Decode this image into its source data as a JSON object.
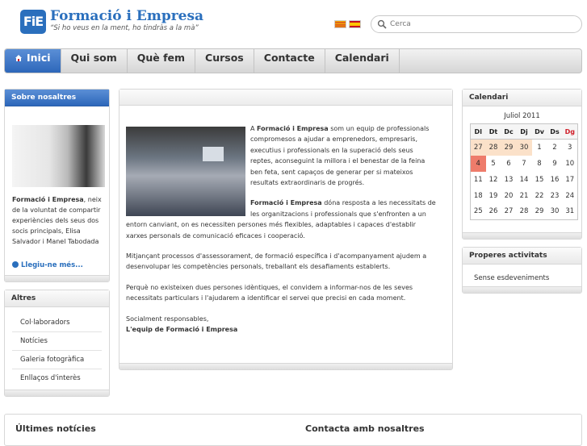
{
  "header": {
    "logo_text": "FiE",
    "site_name": "Formació i Empresa",
    "tagline": "“Si ho veus en la ment, ho tindràs a la mà”",
    "search_placeholder": "Cerca",
    "icons": [
      "catalan-flag-icon",
      "spanish-flag-icon",
      "search-icon"
    ]
  },
  "nav": {
    "items": [
      {
        "label": "Inici",
        "active": true
      },
      {
        "label": "Qui som",
        "active": false
      },
      {
        "label": "Què fem",
        "active": false
      },
      {
        "label": "Cursos",
        "active": false
      },
      {
        "label": "Contacte",
        "active": false
      },
      {
        "label": "Calendari",
        "active": false
      }
    ]
  },
  "about": {
    "title": "Sobre nosaltres",
    "text_bold": "Formació i Empresa",
    "text_rest": ", neix de la voluntat de compartir experiències dels seus dos socis principals, Elisa Salvador i Manel Tabodada",
    "more_label": "Llegiu-ne més..."
  },
  "others": {
    "title": "Altres",
    "items": [
      "Col·laboradors",
      "Notícies",
      "Galeria fotogràfica",
      "Enllaços d'interès"
    ]
  },
  "main": {
    "p1_prefix": "A ",
    "p1_bold": "Formació i Empresa",
    "p1_rest": " som un equip de professionals compromesos a ajudar a emprenedors, empresaris, executius i professionals en la superació dels seus reptes, aconseguint la millora i el benestar de la feina ben feta, sent capaços de generar per si mateixos resultats extraordinaris de progrés.",
    "p2_bold": "Formació i Empresa",
    "p2_rest": " dóna resposta a les necessitats de les organitzacions i professionals que s'enfronten a un entorn canviant, on es necessiten persones més flexibles, adaptables i capaces d'establir xarxes personals de comunicació eficaces i cooperació.",
    "p3": "Mitjançant processos d'assessorament, de formació específica i d'acompanyament ajudem a desenvolupar les competències personals, treballant els desafiaments establerts.",
    "p4": "Perquè no existeixen dues persones idèntiques, el convidem a informar-nos de les seves necessitats particulars i l'ajudarem a identificar el servei que precisi en cada moment.",
    "p5": "Socialment responsables,",
    "signature": "L'equip de Formació i Empresa"
  },
  "calendar": {
    "title": "Calendari",
    "month": "Juliol 2011",
    "days": [
      "Dl",
      "Dt",
      "Dc",
      "Dj",
      "Dv",
      "Ds",
      "Dg"
    ],
    "weeks": [
      [
        "27",
        "28",
        "29",
        "30",
        "1",
        "2",
        "3"
      ],
      [
        "4",
        "5",
        "6",
        "7",
        "8",
        "9",
        "10"
      ],
      [
        "11",
        "12",
        "13",
        "14",
        "15",
        "16",
        "17"
      ],
      [
        "18",
        "19",
        "20",
        "21",
        "22",
        "23",
        "24"
      ],
      [
        "25",
        "26",
        "27",
        "28",
        "29",
        "30",
        "31"
      ]
    ],
    "today": "4",
    "colors": {
      "prev_month": "#fbe1c9",
      "today": "#ee7c6b",
      "sunday": "#d0202a"
    }
  },
  "upcoming": {
    "title": "Properes activitats",
    "empty_text": "Sense esdeveniments"
  },
  "bottom": {
    "news_title": "Últimes notícies",
    "contact_title": "Contacta amb nosaltres"
  },
  "colors": {
    "accent": "#2a6fbd",
    "nav_active": "#2d67ba"
  }
}
